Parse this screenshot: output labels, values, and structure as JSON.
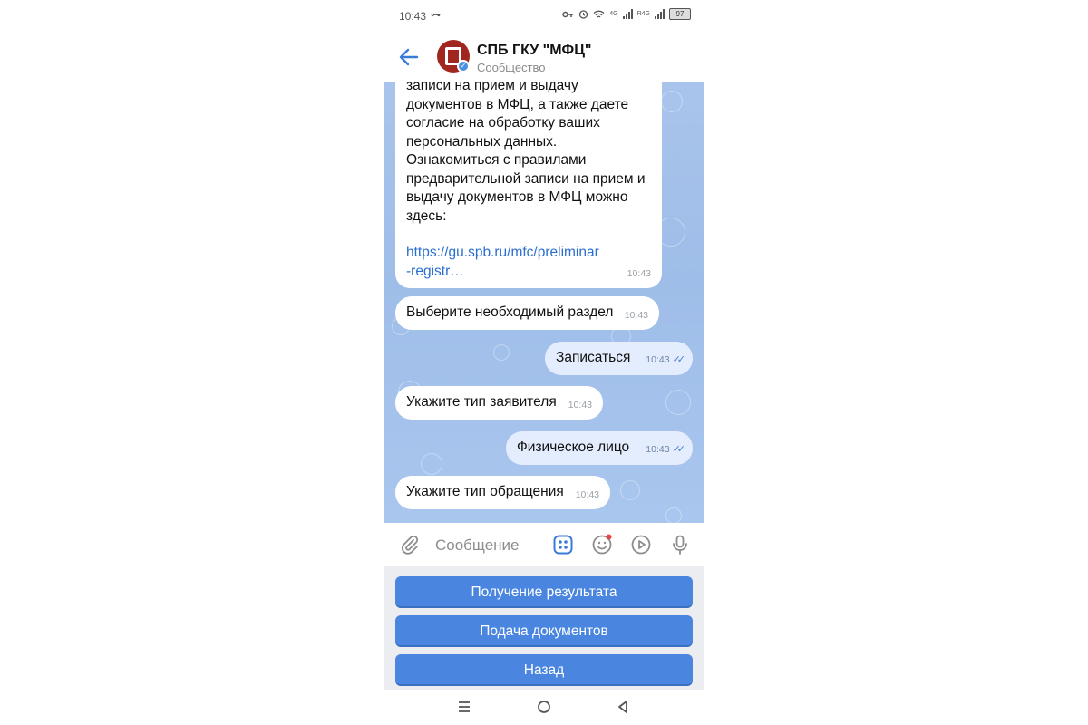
{
  "status": {
    "time": "10:43",
    "key_glyph": "⊶",
    "net1": "4G",
    "net2": "R4G",
    "battery": "97"
  },
  "header": {
    "title": "СПБ ГКУ \"МФЦ\"",
    "subtitle": "Сообщество"
  },
  "messages": [
    {
      "dir": "in",
      "lines": [
        "записи на прием и выдачу",
        "документов в МФЦ, а также даете",
        "согласие на обработку ваших",
        "персональных данных.",
        "Ознакомиться с правилами",
        "предварительной записи на прием и",
        "выдачу документов в МФЦ можно",
        "здесь:"
      ],
      "link": [
        "https://gu.spb.ru/mfc/preliminar",
        "-registr…"
      ],
      "time": "10:43"
    },
    {
      "dir": "in",
      "text": "Выберите необходимый раздел",
      "time": "10:43"
    },
    {
      "dir": "out",
      "text": "Записаться",
      "time": "10:43"
    },
    {
      "dir": "in",
      "text": "Укажите тип заявителя",
      "time": "10:43"
    },
    {
      "dir": "out",
      "text": "Физическое лицо",
      "time": "10:43"
    },
    {
      "dir": "in",
      "text": "Укажите тип обращения",
      "time": "10:43"
    }
  ],
  "composer": {
    "placeholder": "Сообщение"
  },
  "keyboard": [
    {
      "label": "Получение результата"
    },
    {
      "label": "Подача документов"
    },
    {
      "label": "Назад"
    }
  ],
  "icons": {
    "back": "arrow-left-icon",
    "attach": "paperclip-icon",
    "keyboard": "bot-keyboard-icon",
    "emoji": "smile-icon",
    "video": "play-circle-icon",
    "mic": "microphone-icon",
    "nav_menu": "menu-lines-icon",
    "nav_home": "home-circle-icon",
    "nav_back": "triangle-back-icon"
  },
  "colors": {
    "accent": "#4a86e0",
    "bubble_out": "#e4edfd",
    "avatar": "#a1261f",
    "notify_dot": "#e64646"
  }
}
